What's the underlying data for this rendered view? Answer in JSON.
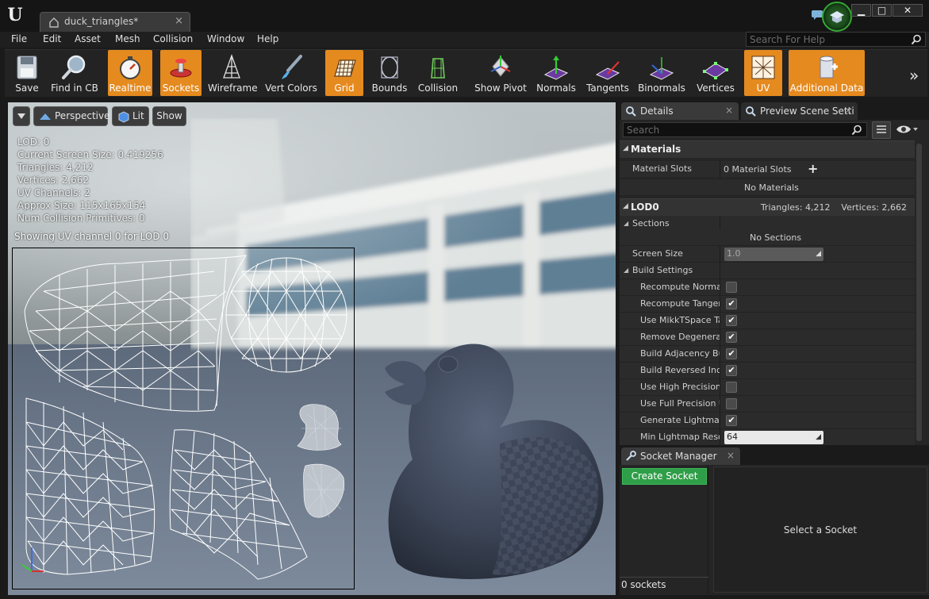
{
  "window": {
    "tab_title": "duck_triangles*",
    "tab_close": "×",
    "minimize": "▁",
    "maximize": "□",
    "close": "✕"
  },
  "menu": {
    "items": [
      "File",
      "Edit",
      "Asset",
      "Mesh",
      "Collision",
      "Window",
      "Help"
    ],
    "help_search_placeholder": "Search For Help"
  },
  "toolbar": {
    "buttons": [
      {
        "label": "Save",
        "icon": "save-disk-icon",
        "active": false
      },
      {
        "label": "Find in CB",
        "icon": "magnifier-icon",
        "active": false
      },
      {
        "label": "Realtime",
        "icon": "stopwatch-icon",
        "active": true
      },
      {
        "label": "Sockets",
        "icon": "sockets-icon",
        "active": true
      },
      {
        "label": "Wireframe",
        "icon": "wireframe-icon",
        "active": false
      },
      {
        "label": "Vert Colors",
        "icon": "paint-brush-icon",
        "active": false
      },
      {
        "label": "Grid",
        "icon": "grid-icon",
        "active": true
      },
      {
        "label": "Bounds",
        "icon": "bounds-icon",
        "active": false
      },
      {
        "label": "Collision",
        "icon": "collision-icon",
        "active": false
      },
      {
        "label": "Show Pivot",
        "icon": "pivot-icon",
        "active": false
      },
      {
        "label": "Normals",
        "icon": "normals-icon",
        "active": false
      },
      {
        "label": "Tangents",
        "icon": "tangents-icon",
        "active": false
      },
      {
        "label": "Binormals",
        "icon": "binormals-icon",
        "active": false
      },
      {
        "label": "Vertices",
        "icon": "vertices-icon",
        "active": false
      },
      {
        "label": "UV",
        "icon": "uv-icon",
        "active": true
      },
      {
        "label": "Additional Data",
        "icon": "additional-data-icon",
        "active": true
      }
    ],
    "more": "»",
    "active_color": "#e58a1f"
  },
  "viewport": {
    "perspective_label": "Perspective",
    "lit_label": "Lit",
    "show_label": "Show",
    "stats": [
      "LOD:  0",
      "Current Screen Size:  0.419256",
      "Triangles:  4,212",
      "Vertices:  2,662",
      "UV Channels:  2",
      "Approx Size: 115x165x154",
      "Num Collision Primitives:  0"
    ],
    "uv_caption": "Showing UV channel 0 for LOD 0"
  },
  "details": {
    "tab_details": "Details",
    "tab_preview": "Preview Scene Setti",
    "tab_close": "×",
    "search_placeholder": "Search",
    "materials_header": "Materials",
    "material_slots_label": "Material Slots",
    "material_slots_value": "0 Material Slots",
    "add_symbol": "+",
    "no_materials": "No Materials",
    "lod_header": "LOD0",
    "lod_summary": "Triangles: 4,212    Vertices: 2,662",
    "sections_label": "Sections",
    "no_sections": "No Sections",
    "screen_size_label": "Screen Size",
    "screen_size_value": "1.0",
    "build_settings_label": "Build Settings",
    "build_settings": [
      {
        "label": "Recompute Normals",
        "checked": false
      },
      {
        "label": "Recompute Tangents",
        "checked": true
      },
      {
        "label": "Use MikkTSpace Tangent Space",
        "checked": true
      },
      {
        "label": "Remove Degenerates",
        "checked": true
      },
      {
        "label": "Build Adjacency Buffer",
        "checked": true
      },
      {
        "label": "Build Reversed Index Buffer",
        "checked": true
      },
      {
        "label": "Use High Precision Tangent Basis",
        "checked": false
      },
      {
        "label": "Use Full Precision UVs",
        "checked": false
      },
      {
        "label": "Generate Lightmap UVs",
        "checked": true
      }
    ],
    "min_lightmap_label": "Min Lightmap Resolution",
    "min_lightmap_value": "64",
    "check_mark": "✔"
  },
  "socket_manager": {
    "tab_label": "Socket Manager",
    "tab_close": "×",
    "create_button": "Create Socket",
    "count": "0 sockets",
    "placeholder": "Select a Socket"
  }
}
